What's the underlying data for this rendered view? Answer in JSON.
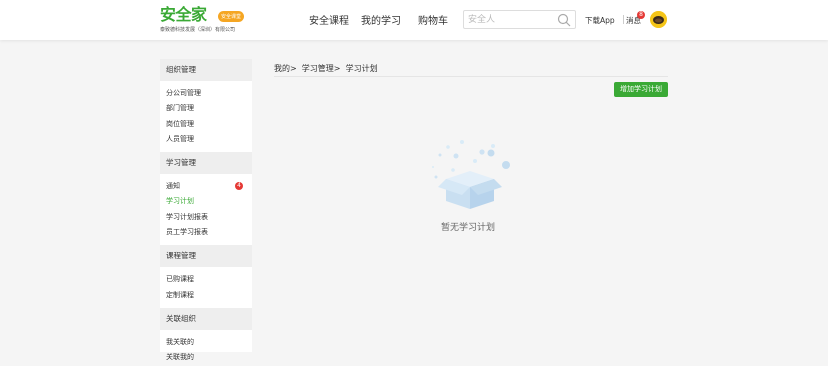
{
  "header": {
    "logo": {
      "title": "安全家",
      "badge": "安全课堂",
      "subtitle": "泰致德科技发展（深圳）有限公司"
    },
    "nav": [
      "安全课程",
      "我的学习",
      "购物车"
    ],
    "search": {
      "placeholder": "安全人",
      "value": ""
    },
    "download_app": "下载App",
    "messages": {
      "label": "消息",
      "count": "8"
    }
  },
  "sidebar": {
    "sections": [
      {
        "title": "组织管理",
        "items": [
          {
            "label": "分公司管理"
          },
          {
            "label": "部门管理"
          },
          {
            "label": "岗位管理"
          },
          {
            "label": "人员管理"
          }
        ]
      },
      {
        "title": "学习管理",
        "items": [
          {
            "label": "通知",
            "badge": "4"
          },
          {
            "label": "学习计划"
          },
          {
            "label": "学习计划报表"
          },
          {
            "label": "员工学习报表"
          }
        ]
      },
      {
        "title": "课程管理",
        "items": [
          {
            "label": "已购课程"
          },
          {
            "label": "定制课程"
          }
        ]
      },
      {
        "title": "关联组织",
        "items": [
          {
            "label": "我关联的"
          },
          {
            "label": "关联我的"
          }
        ]
      }
    ]
  },
  "main": {
    "breadcrumb": [
      "我的",
      "学习管理",
      "学习计划"
    ],
    "breadcrumb_sep": ">",
    "add_button": "增加学习计划",
    "empty_text": "暂无学习计划"
  },
  "colors": {
    "brand_green": "#3aa935",
    "badge_red": "#e53935",
    "logo_badge": "#f5a623"
  }
}
